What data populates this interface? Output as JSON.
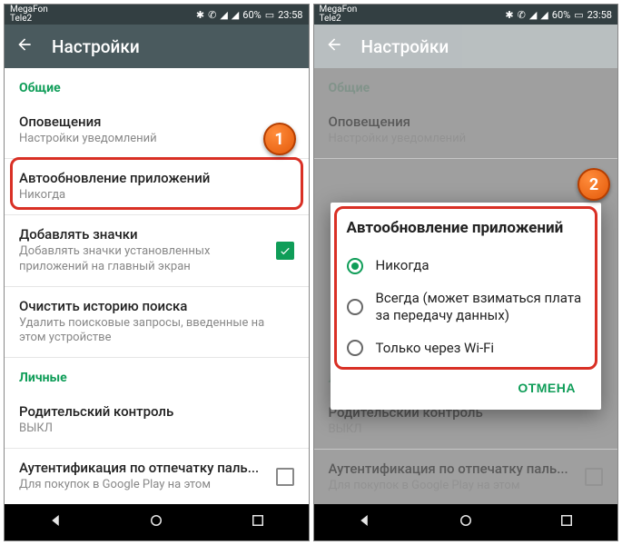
{
  "status": {
    "carrier1": "MegaFon",
    "carrier2": "Tele2",
    "battery": "60%",
    "time": "23:58"
  },
  "appbar": {
    "title": "Настройки"
  },
  "sections": {
    "general": "Общие",
    "personal": "Личные"
  },
  "items": {
    "notifications": {
      "title": "Оповещения",
      "sub": "Настройки уведомлений"
    },
    "autoupdate": {
      "title": "Автообновление приложений",
      "sub": "Никогда"
    },
    "addIcons": {
      "title": "Добавлять значки",
      "sub": "Добавлять значки установленных приложений на главный экран"
    },
    "clearHistory": {
      "title": "Очистить историю поиска",
      "sub": "Удалить поисковые запросы, введенные на этом устройстве"
    },
    "parental": {
      "title": "Родительский контроль",
      "sub": "ВЫКЛ"
    },
    "fingerprint": {
      "title": "Аутентификация по отпечатку паль...",
      "sub": "Для покупок в Google Play на этом"
    }
  },
  "dialog": {
    "title": "Автообновление приложений",
    "options": {
      "never": "Никогда",
      "always": "Всегда (может взиматься плата за передачу данных)",
      "wifi": "Только через Wi-Fi"
    },
    "cancel": "ОТМЕНА"
  },
  "markers": {
    "one": "1",
    "two": "2"
  }
}
